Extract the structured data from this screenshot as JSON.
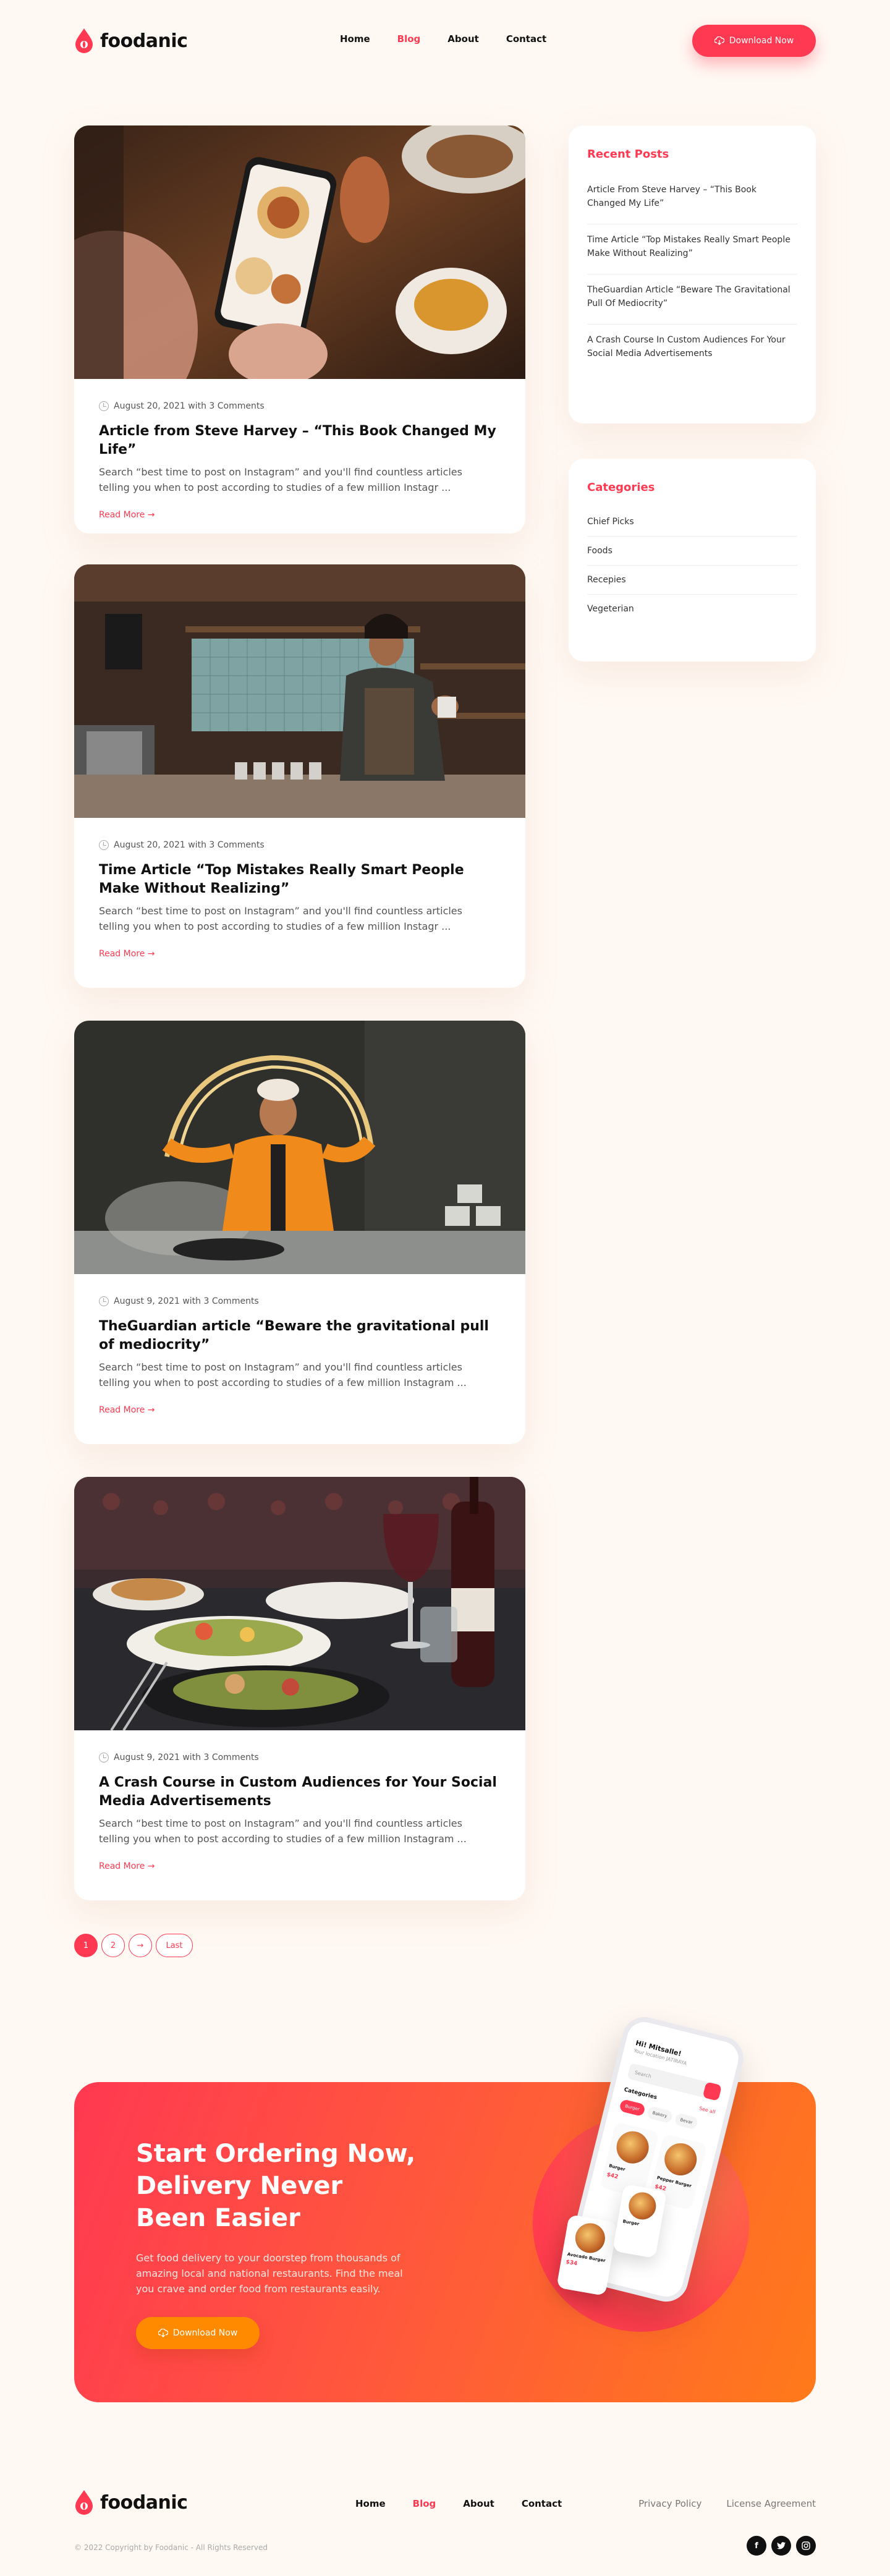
{
  "brand": {
    "name": "foodanic",
    "accent": "#ff3951",
    "orange": "#ff8a00"
  },
  "header": {
    "nav": [
      {
        "label": "Home",
        "active": false
      },
      {
        "label": "Blog",
        "active": true
      },
      {
        "label": "About",
        "active": false
      },
      {
        "label": "Contact",
        "active": false
      }
    ],
    "download_label": "Download Now",
    "download_icon": "cloud-download-icon"
  },
  "posts": [
    {
      "date": "August 20, 2021 with 3 Comments",
      "title": "Article from Steve Harvey – “This Book Changed My Life”",
      "excerpt": "Search “best time to post on Instagram” and you'll find countless articles telling you when to post according to studies of a few million Instagr ...",
      "read_more": "Read More →"
    },
    {
      "date": "August 20, 2021 with 3 Comments",
      "title": "Time Article “Top Mistakes Really Smart People Make Without Realizing”",
      "excerpt": "Search “best time to post on Instagram” and you'll find countless articles telling you when to post according to studies of a few million Instagr ...",
      "read_more": "Read More →"
    },
    {
      "date": "August 9, 2021 with 3 Comments",
      "title": "TheGuardian article “Beware the gravitational pull of mediocrity”",
      "excerpt": "Search “best time to post on Instagram” and you'll find countless articles telling you when to post according to studies of a few million Instagram ...",
      "read_more": "Read More →"
    },
    {
      "date": "August 9, 2021 with 3 Comments",
      "title": "A Crash Course in Custom Audiences for Your Social Media Advertisements",
      "excerpt": "Search “best time to post on Instagram” and you'll find countless articles telling you when to post according to studies of a few million Instagram ...",
      "read_more": "Read More →"
    }
  ],
  "sidebar": {
    "recent_title": "Recent Posts",
    "recent": [
      "Article From Steve Harvey – “This Book Changed My Life”",
      "Time Article “Top Mistakes Really Smart People Make Without Realizing”",
      "TheGuardian Article “Beware The Gravitational Pull Of Mediocrity”",
      "A Crash Course In Custom Audiences For Your Social Media Advertisements"
    ],
    "categories_title": "Categories",
    "categories": [
      "Chief Picks",
      "Foods",
      "Recepies",
      "Vegeterian"
    ]
  },
  "pagination": {
    "pages": [
      "1",
      "2"
    ],
    "next": "→",
    "last": "Last",
    "current": "1"
  },
  "cta": {
    "title": "Start Ordering Now, Delivery Never Been Easier",
    "text": "Get food delivery to your doorstep from thousands of amazing local and national restaurants. Find the meal you crave and order food from restaurants easily.",
    "button": "Download Now",
    "phone": {
      "title": "Hi! Mitsalle!",
      "subtitle": "Your location   JATIRAYA",
      "search": "Search",
      "categories": "Categories",
      "see_all": "See all",
      "chips": [
        "Burger",
        "Bakery",
        "Bevar"
      ],
      "items": [
        {
          "name": "Burger",
          "price": "$42"
        },
        {
          "name": "Pepper Burger",
          "price": "$42"
        }
      ],
      "float_items": [
        {
          "name": "Avocado Burger",
          "price": "$34"
        },
        {
          "name": "Burger",
          "price": "$42"
        }
      ]
    }
  },
  "footer": {
    "nav": [
      {
        "label": "Home",
        "active": false
      },
      {
        "label": "Blog",
        "active": true
      },
      {
        "label": "About",
        "active": false
      },
      {
        "label": "Contact",
        "active": false
      }
    ],
    "privacy": "Privacy Policy",
    "license": "License Agreement",
    "copyright": "© 2022 Copyright by Foodanic - All Rights Reserved",
    "socials": [
      "facebook-icon",
      "twitter-icon",
      "instagram-icon"
    ]
  }
}
